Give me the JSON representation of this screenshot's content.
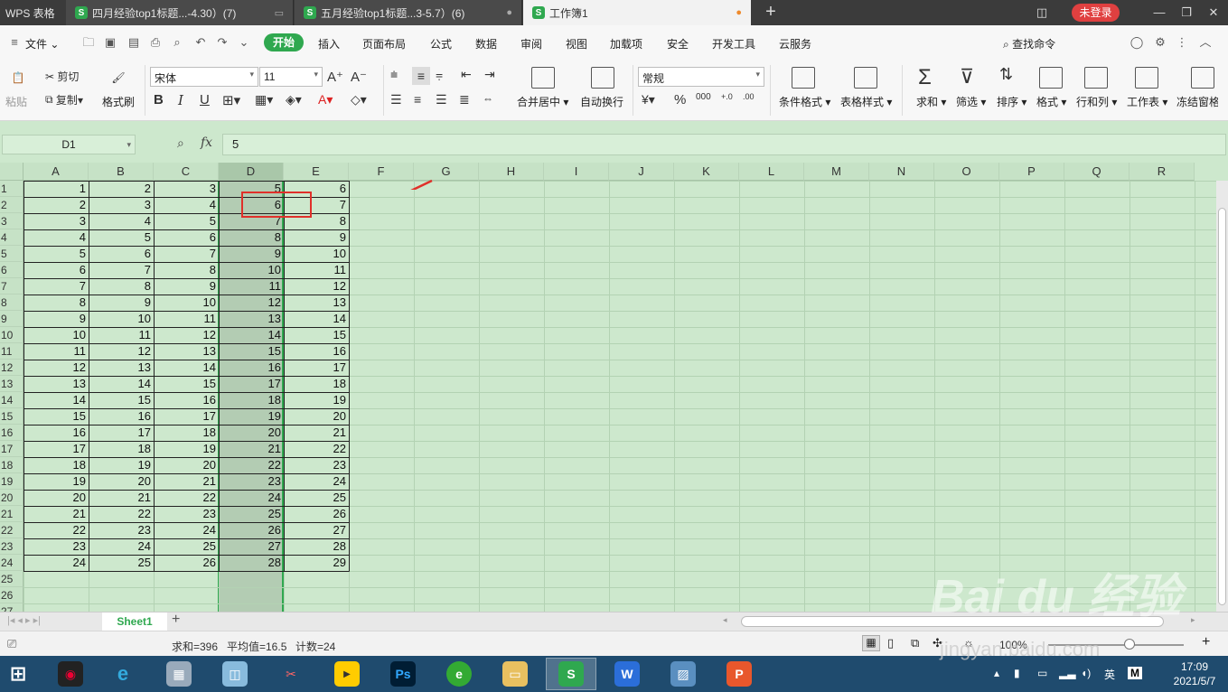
{
  "titlebar": {
    "app_name": "WPS 表格",
    "tabs": [
      {
        "label": "四月经验top1标题...-4.30）(7)",
        "badge": "S"
      },
      {
        "label": "五月经验top1标题...3-5.7）(6)",
        "badge": "S"
      },
      {
        "label": "工作簿1",
        "badge": "S"
      }
    ],
    "login_label": "未登录"
  },
  "menubar": {
    "file_label": "文件",
    "start_label": "开始",
    "items": [
      "插入",
      "页面布局",
      "公式",
      "数据",
      "审阅",
      "视图",
      "加载项",
      "安全",
      "开发工具",
      "云服务"
    ],
    "search_label": "查找命令"
  },
  "ribbon": {
    "paste_label": "粘贴",
    "cut_label": "剪切",
    "copy_label": "复制",
    "format_painter_label": "格式刷",
    "font_name": "宋体",
    "font_size": "11",
    "merge_label": "合并居中",
    "wrap_label": "自动换行",
    "number_format": "常规",
    "conditional_label": "条件格式",
    "table_style_label": "表格样式",
    "sum_label": "求和",
    "filter_label": "筛选",
    "sort_label": "排序",
    "format_label": "格式",
    "rowcol_label": "行和列",
    "worksheet_label": "工作表",
    "freeze_label": "冻结窗格"
  },
  "formula_bar": {
    "name_box": "D1",
    "fx_label": "fx",
    "formula": "5"
  },
  "sheet": {
    "columns": [
      "A",
      "B",
      "C",
      "D",
      "E",
      "F",
      "G",
      "H",
      "I",
      "J",
      "K",
      "L",
      "M",
      "N",
      "O",
      "P",
      "Q",
      "R"
    ],
    "rows": [
      "1",
      "2",
      "3",
      "4",
      "5",
      "6",
      "7",
      "8",
      "9",
      "10",
      "11",
      "12",
      "13",
      "14",
      "15",
      "16",
      "17",
      "18",
      "19",
      "20",
      "21",
      "22",
      "23",
      "24",
      "25",
      "26",
      "27"
    ],
    "data": [
      [
        1,
        2,
        3,
        5,
        6
      ],
      [
        2,
        3,
        4,
        6,
        7
      ],
      [
        3,
        4,
        5,
        7,
        8
      ],
      [
        4,
        5,
        6,
        8,
        9
      ],
      [
        5,
        6,
        7,
        9,
        10
      ],
      [
        6,
        7,
        8,
        10,
        11
      ],
      [
        7,
        8,
        9,
        11,
        12
      ],
      [
        8,
        9,
        10,
        12,
        13
      ],
      [
        9,
        10,
        11,
        13,
        14
      ],
      [
        10,
        11,
        12,
        14,
        15
      ],
      [
        11,
        12,
        13,
        15,
        16
      ],
      [
        12,
        13,
        14,
        16,
        17
      ],
      [
        13,
        14,
        15,
        17,
        18
      ],
      [
        14,
        15,
        16,
        18,
        19
      ],
      [
        15,
        16,
        17,
        19,
        20
      ],
      [
        16,
        17,
        18,
        20,
        21
      ],
      [
        17,
        18,
        19,
        21,
        22
      ],
      [
        18,
        19,
        20,
        22,
        23
      ],
      [
        19,
        20,
        21,
        23,
        24
      ],
      [
        20,
        21,
        22,
        24,
        25
      ],
      [
        21,
        22,
        23,
        25,
        26
      ],
      [
        22,
        23,
        24,
        26,
        27
      ],
      [
        23,
        24,
        25,
        27,
        28
      ],
      [
        24,
        25,
        26,
        28,
        29
      ]
    ],
    "selected_column": "D",
    "active_cell": "D1"
  },
  "sheet_tabs": {
    "sheets": [
      "Sheet1"
    ],
    "add_label": "+"
  },
  "statusbar": {
    "sum": "求和=396",
    "average": "平均值=16.5",
    "count": "计数=24",
    "zoom": "100%"
  },
  "taskbar": {
    "apps": [
      "Ps",
      "S",
      "W",
      "P"
    ],
    "ime": "英",
    "time": "17:09",
    "date": "2021/5/7"
  },
  "watermark": {
    "text": "Bai du 经验",
    "url": "jingyan.baidu.com"
  },
  "colors": {
    "accent": "#2fa84f",
    "grid_bg": "#cde8cd",
    "callout": "#e0302a",
    "login": "#e04040"
  }
}
